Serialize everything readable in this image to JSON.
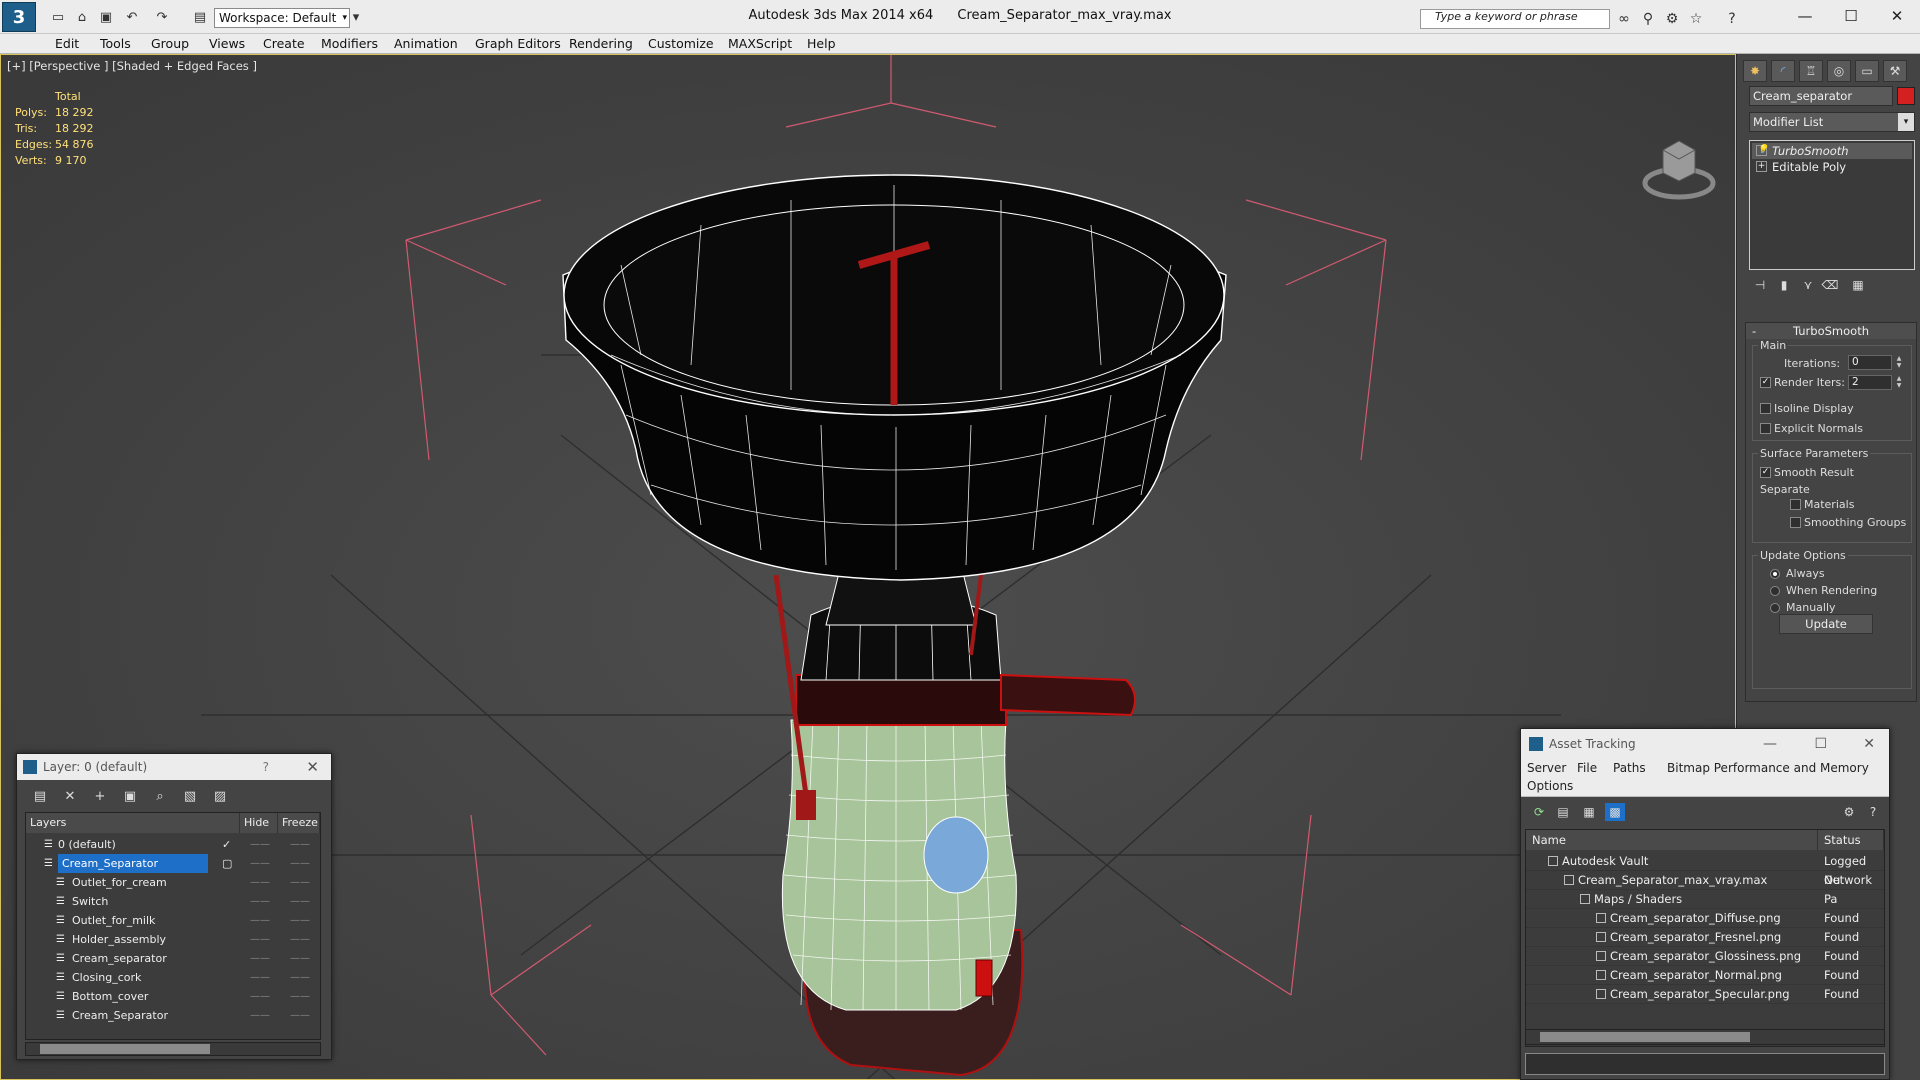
{
  "titlebar": {
    "app_title": "Autodesk 3ds Max  2014 x64",
    "file_title": "Cream_Separator_max_vray.max",
    "workspace": "Workspace: Default",
    "search_placeholder": "Type a keyword or phrase",
    "logo": "3"
  },
  "menu": [
    "Edit",
    "Tools",
    "Group",
    "Views",
    "Create",
    "Modifiers",
    "Animation",
    "Graph Editors",
    "Rendering",
    "Customize",
    "MAXScript",
    "Help"
  ],
  "viewport": {
    "label": "[+] [Perspective ] [Shaded + Edged Faces ]",
    "stats": {
      "header": "Total",
      "polys_label": "Polys:",
      "polys": "18 292",
      "tris_label": "Tris:",
      "tris": "18 292",
      "edges_label": "Edges:",
      "edges": "54 876",
      "verts_label": "Verts:",
      "verts": "9 170"
    }
  },
  "command_panel": {
    "object_name": "Cream_separator",
    "object_color": "#d42020",
    "modifier_list": "Modifier List",
    "stack": [
      "TurboSmooth",
      "Editable Poly"
    ],
    "rollout_title": "TurboSmooth",
    "main_label": "Main",
    "iterations_label": "Iterations:",
    "iterations": "0",
    "render_iters_label": "Render Iters:",
    "render_iters": "2",
    "isoline_label": "Isoline Display",
    "explicit_normals_label": "Explicit Normals",
    "surface_label": "Surface Parameters",
    "smooth_result_label": "Smooth Result",
    "separate_label": "Separate",
    "materials_label": "Materials",
    "smoothing_groups_label": "Smoothing Groups",
    "update_options_label": "Update Options",
    "always_label": "Always",
    "when_rendering_label": "When Rendering",
    "manually_label": "Manually",
    "update_button": "Update"
  },
  "layer_dialog": {
    "title": "Layer: 0 (default)",
    "help": "?",
    "col_layers": "Layers",
    "col_hide": "Hide",
    "col_freeze": "Freeze",
    "rows": [
      {
        "name": "0 (default)",
        "level": 0
      },
      {
        "name": "Cream_Separator",
        "level": 0,
        "selected": true
      },
      {
        "name": "Outlet_for_cream",
        "level": 1
      },
      {
        "name": "Switch",
        "level": 1
      },
      {
        "name": "Outlet_for_milk",
        "level": 1
      },
      {
        "name": "Holder_assembly",
        "level": 1
      },
      {
        "name": "Cream_separator",
        "level": 1
      },
      {
        "name": "Closing_cork",
        "level": 1
      },
      {
        "name": "Bottom_cover",
        "level": 1
      },
      {
        "name": "Cream_Separator",
        "level": 1
      }
    ]
  },
  "asset_dialog": {
    "title": "Asset Tracking",
    "menu": [
      "Server",
      "File",
      "Paths",
      "Bitmap Performance and Memory",
      "Options"
    ],
    "col_name": "Name",
    "col_status": "Status",
    "rows": [
      {
        "name": "Autodesk Vault",
        "status": "Logged Ou",
        "level": 0
      },
      {
        "name": "Cream_Separator_max_vray.max",
        "status": "Network Pa",
        "level": 1
      },
      {
        "name": "Maps / Shaders",
        "status": "",
        "level": 2
      },
      {
        "name": "Cream_separator_Diffuse.png",
        "status": "Found",
        "level": 3
      },
      {
        "name": "Cream_separator_Fresnel.png",
        "status": "Found",
        "level": 3
      },
      {
        "name": "Cream_separator_Glossiness.png",
        "status": "Found",
        "level": 3
      },
      {
        "name": "Cream_separator_Normal.png",
        "status": "Found",
        "level": 3
      },
      {
        "name": "Cream_separator_Specular.png",
        "status": "Found",
        "level": 3
      }
    ]
  }
}
